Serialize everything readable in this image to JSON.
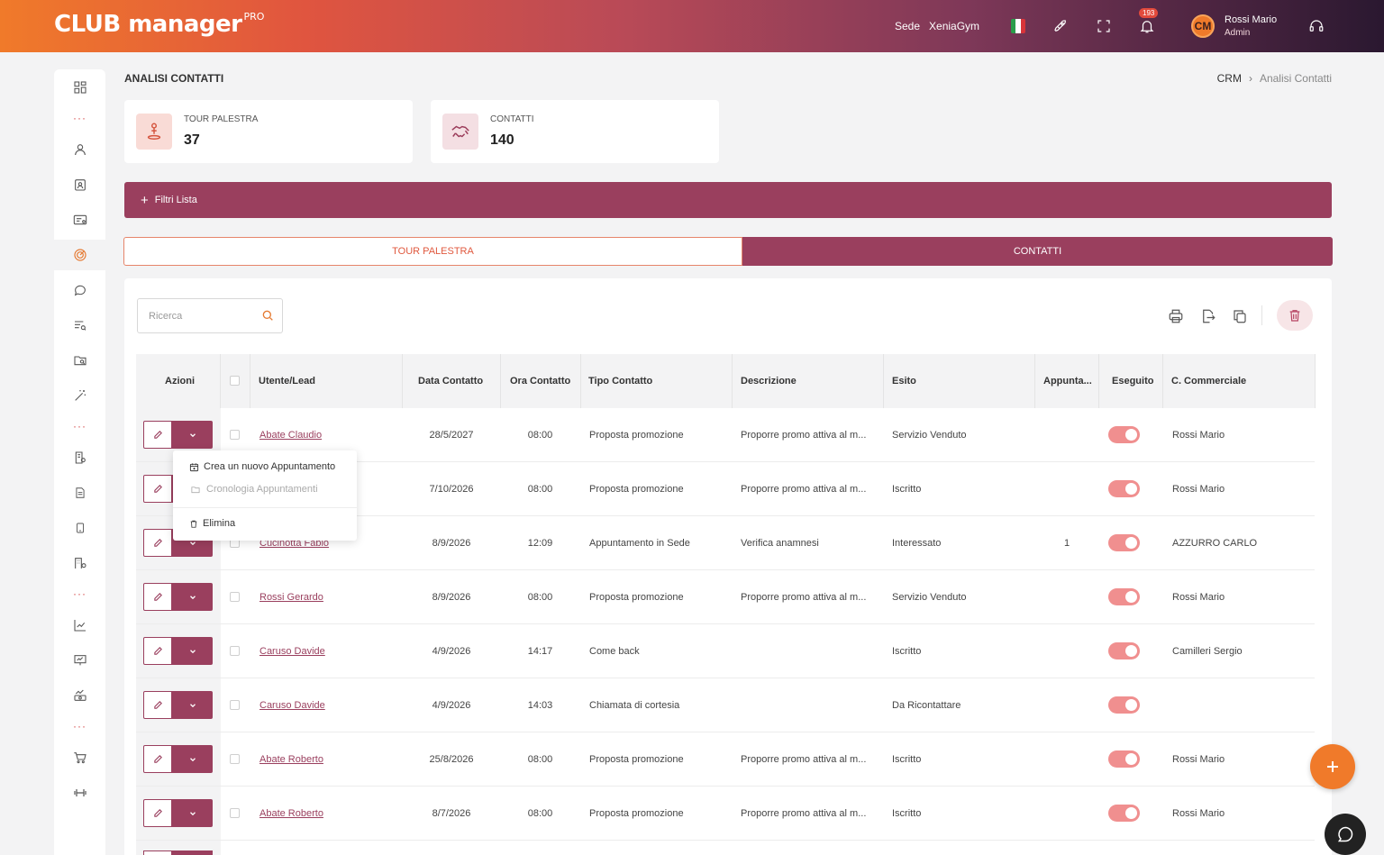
{
  "app": {
    "logo_main": "CLUB manager",
    "logo_pro": "PRO"
  },
  "header": {
    "sede_label": "Sede",
    "sede_value": "XeniaGym",
    "notifications_count": "193",
    "avatar_initials": "CM",
    "user_name": "Rossi Mario",
    "user_role": "Admin"
  },
  "page": {
    "title": "ANALISI CONTATTI",
    "breadcrumb": {
      "root": "CRM",
      "current": "Analisi Contatti"
    }
  },
  "kpis": [
    {
      "label": "TOUR PALESTRA",
      "value": "37",
      "icon": "tour-icon"
    },
    {
      "label": "CONTATTI",
      "value": "140",
      "icon": "handshake-icon"
    }
  ],
  "filters": {
    "label": "Filtri Lista"
  },
  "tabs": [
    {
      "label": "TOUR PALESTRA",
      "active": false
    },
    {
      "label": "CONTATTI",
      "active": true
    }
  ],
  "search": {
    "placeholder": "Ricerca",
    "value": ""
  },
  "table": {
    "headers": {
      "azioni": "Azioni",
      "utente": "Utente/Lead",
      "data": "Data Contatto",
      "ora": "Ora Contatto",
      "tipo": "Tipo Contatto",
      "descrizione": "Descrizione",
      "esito": "Esito",
      "appuntamenti": "Appunta...",
      "eseguito": "Eseguito",
      "commerciale": "C. Commerciale"
    },
    "rows": [
      {
        "utente": "Abate Claudio",
        "data": "28/5/2027",
        "ora": "08:00",
        "tipo": "Proposta promozione",
        "descrizione": "Proporre promo attiva al m...",
        "esito": "Servizio Venduto",
        "appuntamenti": "",
        "commerciale": "Rossi Mario"
      },
      {
        "utente": "",
        "data": "7/10/2026",
        "ora": "08:00",
        "tipo": "Proposta promozione",
        "descrizione": "Proporre promo attiva al m...",
        "esito": "Iscritto",
        "appuntamenti": "",
        "commerciale": "Rossi Mario"
      },
      {
        "utente": "Cucinotta Fabio",
        "data": "8/9/2026",
        "ora": "12:09",
        "tipo": "Appuntamento in Sede",
        "descrizione": "Verifica anamnesi",
        "esito": "Interessato",
        "appuntamenti": "1",
        "commerciale": "AZZURRO CARLO"
      },
      {
        "utente": "Rossi Gerardo",
        "data": "8/9/2026",
        "ora": "08:00",
        "tipo": "Proposta promozione",
        "descrizione": "Proporre promo attiva al m...",
        "esito": "Servizio Venduto",
        "appuntamenti": "",
        "commerciale": "Rossi Mario"
      },
      {
        "utente": "Caruso Davide",
        "data": "4/9/2026",
        "ora": "14:17",
        "tipo": "Come back",
        "descrizione": "",
        "esito": "Iscritto",
        "appuntamenti": "",
        "commerciale": "Camilleri Sergio"
      },
      {
        "utente": "Caruso Davide",
        "data": "4/9/2026",
        "ora": "14:03",
        "tipo": "Chiamata di cortesia",
        "descrizione": "",
        "esito": "Da Ricontattare",
        "appuntamenti": "",
        "commerciale": ""
      },
      {
        "utente": "Abate Roberto",
        "data": "25/8/2026",
        "ora": "08:00",
        "tipo": "Proposta promozione",
        "descrizione": "Proporre promo attiva al m...",
        "esito": "Iscritto",
        "appuntamenti": "",
        "commerciale": "Rossi Mario"
      },
      {
        "utente": "Abate Roberto",
        "data": "8/7/2026",
        "ora": "08:00",
        "tipo": "Proposta promozione",
        "descrizione": "Proporre promo attiva al m...",
        "esito": "Iscritto",
        "appuntamenti": "",
        "commerciale": "Rossi Mario"
      }
    ]
  },
  "dropdown_menu": {
    "items": [
      {
        "label": "Crea un nuovo Appuntamento",
        "enabled": true
      },
      {
        "label": "Cronologia Appuntamenti",
        "enabled": false
      },
      {
        "label": "Elimina",
        "enabled": true
      }
    ]
  },
  "colors": {
    "brand": "#9a3f5e",
    "accent": "#f07a2a",
    "toggle_on": "#f08f8f"
  }
}
